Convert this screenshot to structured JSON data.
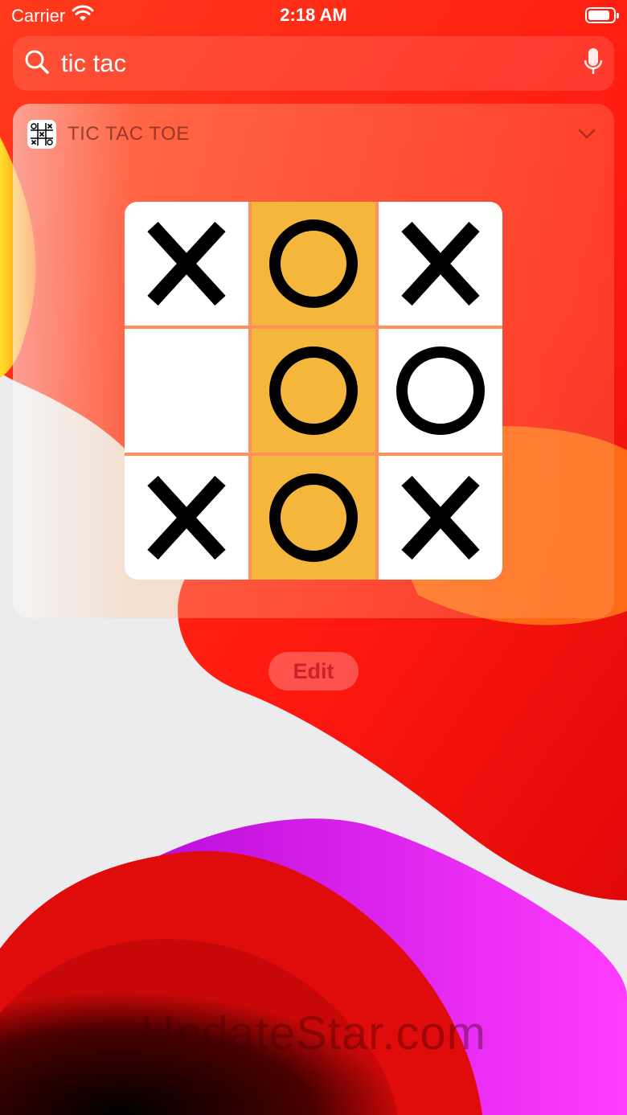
{
  "status_bar": {
    "carrier": "Carrier",
    "time": "2:18 AM",
    "battery_level": 0.85
  },
  "search": {
    "value": "tic tac",
    "placeholder": "Search"
  },
  "widget": {
    "title": "TIC TAC TOE",
    "board": [
      [
        "X",
        "O",
        "X"
      ],
      [
        "",
        "O",
        "O"
      ],
      [
        "X",
        "O",
        "X"
      ]
    ],
    "winning_column": 1,
    "colors": {
      "cell": "#ffffff",
      "highlight": "#f4b73c",
      "mark": "#000000",
      "grid": "#ff8f5e"
    }
  },
  "edit_button": {
    "label": "Edit"
  },
  "watermark": "UpdateStar.com"
}
